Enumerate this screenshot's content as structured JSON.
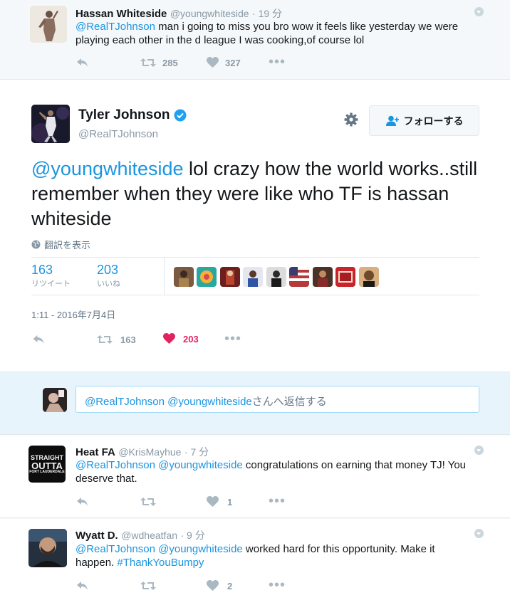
{
  "top_tweet": {
    "name": "Hassan Whiteside",
    "handle": "@youngwhiteside",
    "time": "· 19 分",
    "mention": "@RealTJohnson",
    "text": " man i going to miss you bro wow it feels like yesterday we were playing each other in the d league I was cooking,of course lol",
    "retweets": "285",
    "likes": "327"
  },
  "main_tweet": {
    "name": "Tyler Johnson",
    "handle": "@RealTJohnson",
    "follow_label": "フォローする",
    "mention": "@youngwhiteside",
    "text": " lol crazy how the world works..still remember when they were like who TF is hassan whiteside",
    "translate": "翻訳を表示",
    "retweet_count": "163",
    "retweet_label": "リツイート",
    "like_count": "203",
    "like_label": "いいね",
    "timestamp": "1:11 - 2016年7月4日",
    "action_retweets": "163",
    "action_likes": "203",
    "liked_color": "#e0245e",
    "verified_color": "#1da1f2"
  },
  "reply_box": {
    "mentions": "@RealTJohnson @youngwhiteside",
    "suffix": "さんへ返信する"
  },
  "replies": [
    {
      "name": "Heat FA",
      "handle": "@KrisMayhue",
      "time": "· 7 分",
      "mention": "@RealTJohnson @youngwhiteside",
      "text": " congratulations on earning that money TJ! You deserve that.",
      "likes": "1",
      "avatar_text": [
        "STRAIGHT",
        "OUTTA",
        "FORT LAUDERDALE"
      ]
    },
    {
      "name": "Wyatt D.",
      "handle": "@wdheatfan",
      "time": "· 9 分",
      "mention": "@RealTJohnson @youngwhiteside",
      "text": " worked hard for this opportunity. Make it happen. ",
      "hashtag": "#ThankYouBumpy",
      "likes": "2"
    }
  ]
}
